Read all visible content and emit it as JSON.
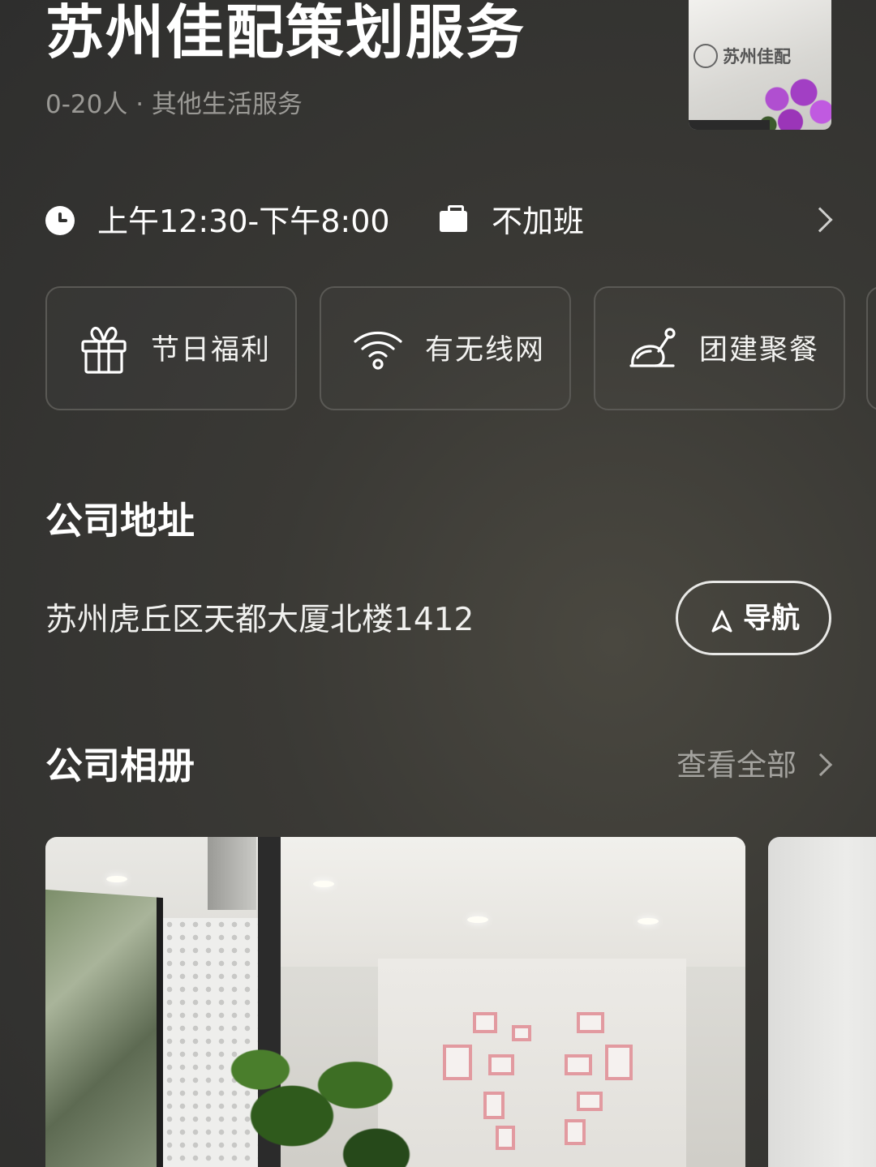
{
  "company": {
    "name": "苏州佳配策划服务",
    "subtitle": "0-20人 · 其他生活服务",
    "logo_text": "苏州佳配"
  },
  "work_info": {
    "hours": "上午12:30-下午8:00",
    "overtime": "不加班",
    "icons": [
      "clock-icon",
      "briefcase-icon",
      "chevron-right-icon"
    ]
  },
  "benefits": [
    {
      "label": "节日福利",
      "icon": "gift-icon"
    },
    {
      "label": "有无线网",
      "icon": "wifi-icon"
    },
    {
      "label": "团建聚餐",
      "icon": "roast-chicken-icon"
    }
  ],
  "address_section": {
    "title": "公司地址",
    "address": "苏州虎丘区天都大厦北楼1412",
    "nav_label": "导航"
  },
  "album_section": {
    "title": "公司相册",
    "view_all": "查看全部"
  },
  "colors": {
    "background": "#343432",
    "muted_text": "#9a9995",
    "card_border": "#5a5955",
    "photo_frame_accent": "#e29aa0"
  }
}
